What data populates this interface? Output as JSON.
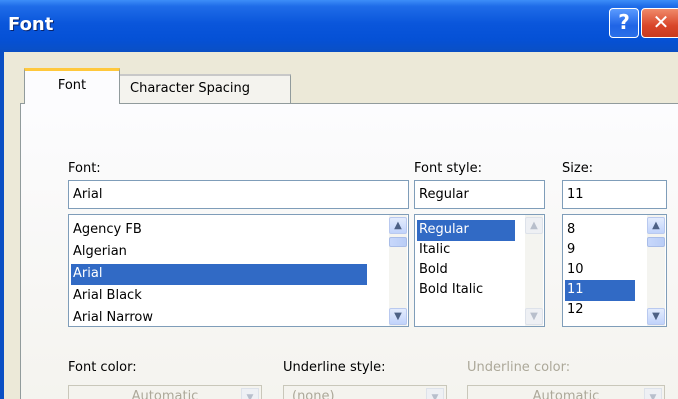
{
  "window": {
    "title": "Font",
    "help_label": "?",
    "close_label": "✕"
  },
  "tabs": [
    {
      "label": "Font",
      "active": true
    },
    {
      "label": "Character Spacing",
      "active": false
    }
  ],
  "font": {
    "label": "Font:",
    "value": "Arial",
    "items": [
      "Agency FB",
      "Algerian",
      "Arial",
      "Arial Black",
      "Arial Narrow"
    ],
    "selected": "Arial"
  },
  "style": {
    "label": "Font style:",
    "value": "Regular",
    "items": [
      "Regular",
      "Italic",
      "Bold",
      "Bold Italic"
    ],
    "selected": "Regular"
  },
  "size": {
    "label": "Size:",
    "value": "11",
    "items": [
      "8",
      "9",
      "10",
      "11",
      "12"
    ],
    "selected": "11"
  },
  "font_color": {
    "label": "Font color:",
    "value": "Automatic"
  },
  "underline_style": {
    "label": "Underline style:",
    "value": "(none)"
  },
  "underline_color": {
    "label": "Underline color:",
    "value": "Automatic"
  },
  "colors": {
    "selection": "#316ac5",
    "title_bar": "#0a56db",
    "dialog": "#ece9d8",
    "active_tab": "#ffc83c"
  }
}
